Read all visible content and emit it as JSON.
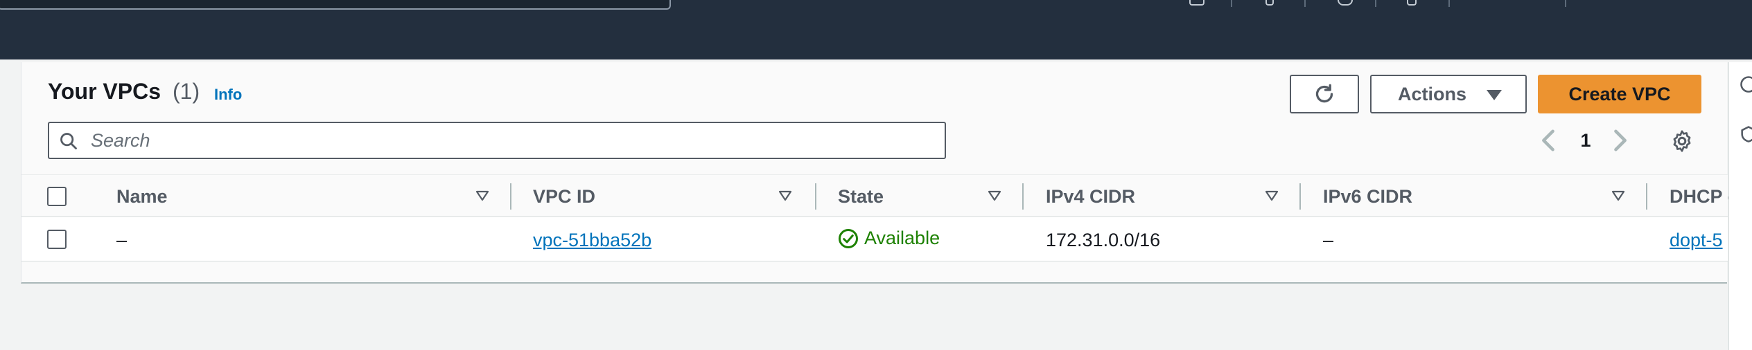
{
  "top_nav": {
    "search_glyph": "⌕"
  },
  "header": {
    "title": "Your VPCs",
    "count": "(1)",
    "info_link": "Info"
  },
  "toolbar": {
    "refresh_icon": "refresh-icon",
    "actions_label": "Actions",
    "create_label": "Create VPC"
  },
  "search": {
    "placeholder": "Search",
    "value": ""
  },
  "pagination": {
    "current_page": "1"
  },
  "table": {
    "columns": [
      "Name",
      "VPC ID",
      "State",
      "IPv4 CIDR",
      "IPv6 CIDR",
      "DHCP o"
    ],
    "rows": [
      {
        "name": "–",
        "vpc_id": "vpc-51bba52b",
        "state": "Available",
        "ipv4_cidr": "172.31.0.0/16",
        "ipv6_cidr": "–",
        "dhcp": "dopt-5"
      }
    ]
  },
  "colors": {
    "nav_bg": "#232f3e",
    "primary_button": "#ec9330",
    "link": "#0073bb",
    "status_ok": "#1d8102"
  }
}
